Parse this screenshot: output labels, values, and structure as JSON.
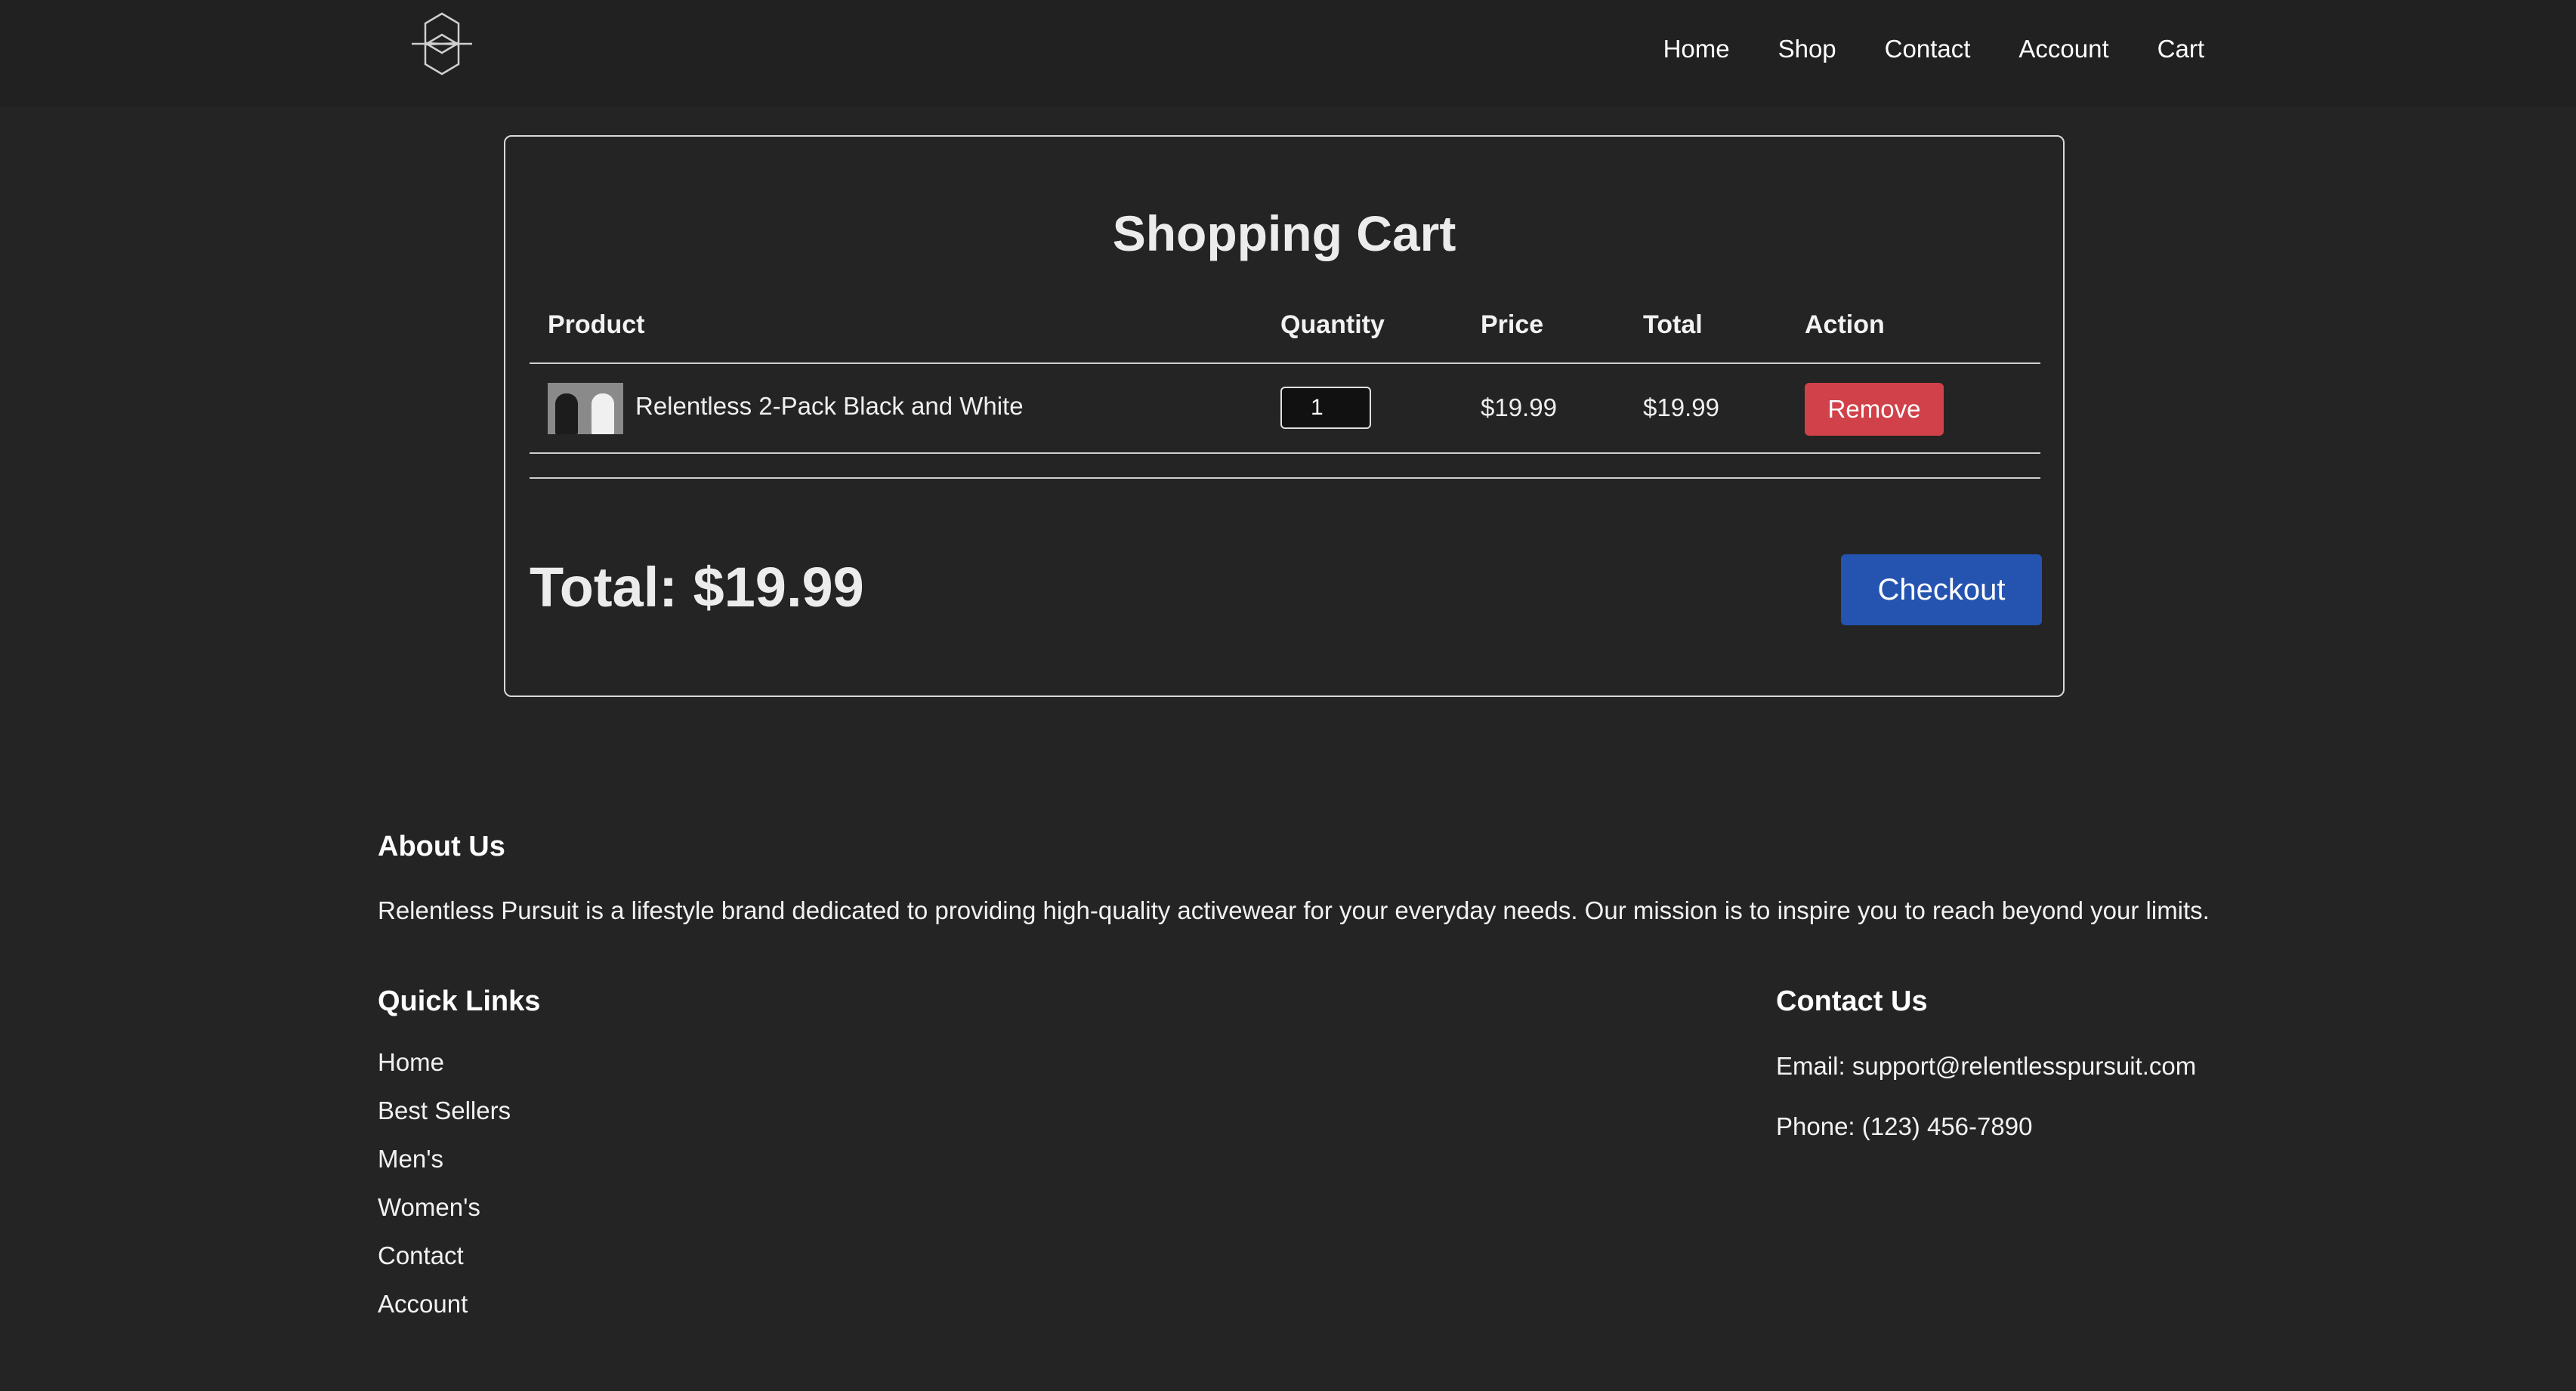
{
  "nav": {
    "logo": "hexagon-logo",
    "links": [
      "Home",
      "Shop",
      "Contact",
      "Account",
      "Cart"
    ]
  },
  "cart": {
    "title": "Shopping Cart",
    "columns": {
      "product": "Product",
      "quantity": "Quantity",
      "price": "Price",
      "total": "Total",
      "action": "Action"
    },
    "items": [
      {
        "name": "Relentless 2-Pack Black and White",
        "quantity": "1",
        "price": "$19.99",
        "total": "$19.99",
        "action_label": "Remove"
      }
    ],
    "grand_total": "Total: $19.99",
    "checkout_label": "Checkout"
  },
  "footer": {
    "about": {
      "heading": "About Us",
      "text": "Relentless Pursuit is a lifestyle brand dedicated to providing high-quality activewear for your everyday needs. Our mission is to inspire you to reach beyond your limits."
    },
    "quick_links": {
      "heading": "Quick Links",
      "items": [
        "Home",
        "Best Sellers",
        "Men's",
        "Women's",
        "Contact",
        "Account"
      ]
    },
    "contact": {
      "heading": "Contact Us",
      "email": "Email: support@relentlesspursuit.com",
      "phone": "Phone: (123) 456-7890"
    }
  },
  "colors": {
    "background": "#242424",
    "remove_button": "#d0414a",
    "checkout_button": "#2453b0"
  }
}
